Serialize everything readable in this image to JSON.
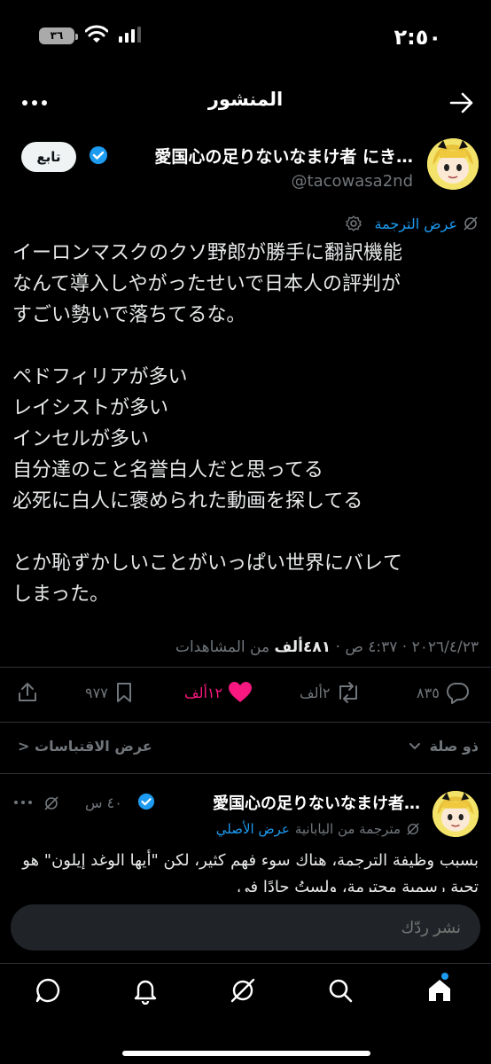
{
  "status": {
    "time": "٢:٥٠",
    "battery": "٣٦"
  },
  "header": {
    "title": "المنشور"
  },
  "author": {
    "name": "愛国心の足りないなまけ者 にき…",
    "handle": "@tacowasa2nd",
    "follow_label": "تابع"
  },
  "translation": {
    "link": "عرض الترجمة"
  },
  "post": {
    "text": "イーロンマスクのクソ野郎が勝手に翻訳機能\nなんて導入しやがったせいで日本人の評判が\nすごい勢いで落ちてるな。\n\nペドフィリアが多い\nレイシストが多い\nインセルが多い\n自分達のこと名誉白人だと思ってる\n必死に白人に褒められた動画を探してる\n\nとか恥ずかしいことがいっぱい世界にバレて\nしまった。",
    "date_time": "٢٠٢٦/٤/٢٣ · ٤:٣٧ ص · ",
    "views_count": "٤٨١ألف",
    "views_label": " من المشاهدات"
  },
  "actions": {
    "replies": "٨٣٥",
    "reposts": "٢ألف",
    "likes": "١٢ألف",
    "bookmarks": "٩٧٧"
  },
  "quotes": {
    "sort_label": "ذو صلة",
    "view_quotes": "عرض الاقتباسات"
  },
  "reply": {
    "name": "愛国心の足りないなまけ者…",
    "time": "٤٠ س",
    "translated_from": "مترجمة من اليابانية",
    "show_original": "عرض الأصلي",
    "text": "بسبب وظيفة الترجمة، هناك سوء فهم كثير، لكن \"أيها الوغد إيلون\" هو تحية رسمية محترمة، ولستُ جادًا في"
  },
  "compose": {
    "placeholder": "نشر ردّك"
  },
  "colors": {
    "accent": "#1d9bf0",
    "like": "#f91880",
    "muted": "#71767b"
  }
}
